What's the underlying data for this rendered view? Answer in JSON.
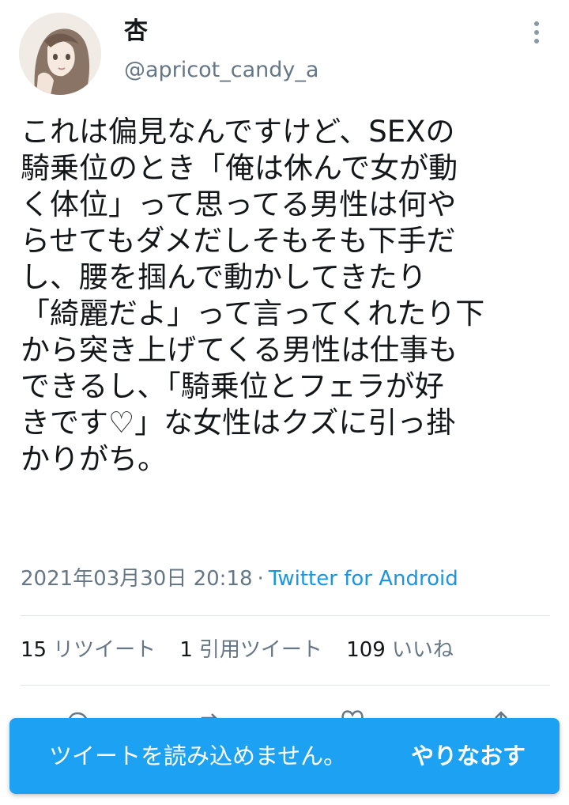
{
  "user": {
    "display_name": "杏",
    "handle": "@apricot_candy_a"
  },
  "tweet": {
    "lines": [
      "これは偏見なんですけど、SEXの",
      "騎乗位のとき「俺は休んで女が動",
      "く体位」って思ってる男性は何や",
      "らせてもダメだしそもそも下手だ",
      "し、腰を掴んで動かしてきたり",
      "「綺麗だよ」って言ってくれたり下",
      "から突き上げてくる男性は仕事も",
      "できるし、「騎乗位とフェラが好",
      "きです♡」な女性はクズに引っ掛",
      "かりがち。"
    ],
    "timestamp": "2021年03月30日 20:18",
    "separator": "·",
    "source": "Twitter for Android"
  },
  "stats": {
    "retweets": {
      "count": "15",
      "label": "リツイート"
    },
    "quotes": {
      "count": "1",
      "label": "引用ツイート"
    },
    "likes": {
      "count": "109",
      "label": "いいね"
    }
  },
  "toast": {
    "message": "ツイートを読み込めません。",
    "retry_label": "やりなおす"
  },
  "icons": {
    "more": "more-vertical-icon",
    "reply": "reply-icon",
    "retweet": "retweet-icon",
    "like": "heart-icon",
    "share": "share-icon"
  },
  "colors": {
    "accent": "#1da1f2",
    "link": "#1b95e0",
    "secondary_text": "#657786",
    "divider": "#e1e8ed"
  }
}
